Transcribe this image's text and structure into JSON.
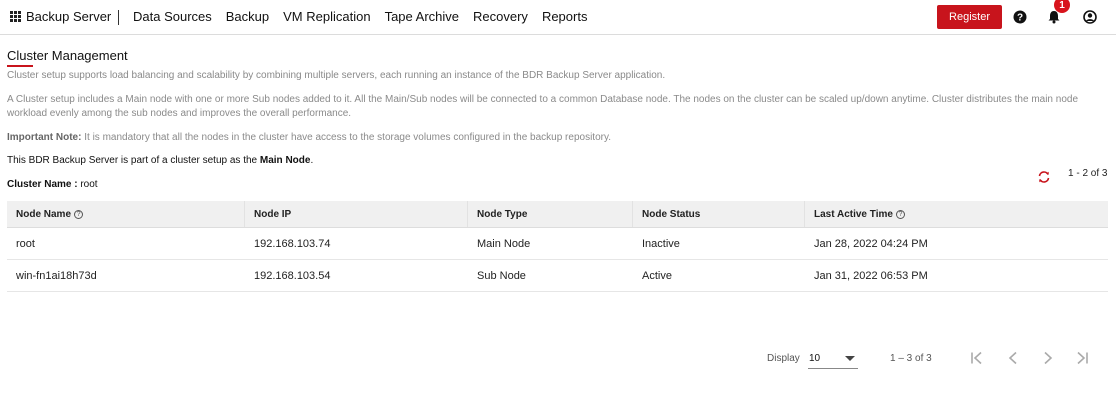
{
  "app": {
    "brand": "Backup Server"
  },
  "nav": {
    "items": [
      "Data Sources",
      "Backup",
      "VM Replication",
      "Tape Archive",
      "Recovery",
      "Reports"
    ]
  },
  "header": {
    "register_label": "Register",
    "notification_count": "1"
  },
  "page": {
    "title": "Cluster Management",
    "p1": "Cluster setup supports load balancing and scalability by combining multiple servers, each running an instance of the BDR Backup Server application.",
    "p2": "A Cluster setup includes a Main node with one or more Sub nodes added to it. All the Main/Sub nodes will be connected to a common Database node. The nodes on the cluster can be scaled up/down anytime. Cluster distributes the main node workload evenly among the sub nodes and improves the overall performance.",
    "note_label": "Important Note:",
    "note_text": " It is mandatory that all the nodes in the cluster have access to the storage volumes configured in the backup repository.",
    "main_info_prefix": "This BDR Backup Server is part of a cluster setup as the ",
    "main_info_role": "Main Node",
    "main_info_suffix": ".",
    "cluster_name_label": "Cluster Name :",
    "cluster_name_value": " root",
    "count_top": "1 - 2 of 3"
  },
  "table": {
    "headers": [
      "Node Name",
      "Node IP",
      "Node Type",
      "Node Status",
      "Last Active Time"
    ],
    "rows": [
      [
        "root",
        "192.168.103.74",
        "Main Node",
        "Inactive",
        "Jan 28, 2022 04:24 PM"
      ],
      [
        "win-fn1ai18h73d",
        "192.168.103.54",
        "Sub Node",
        "Active",
        "Jan 31, 2022 06:53 PM"
      ]
    ]
  },
  "pagination": {
    "display_label": "Display",
    "page_size": "10",
    "range": "1 – 3 of 3"
  },
  "colors": {
    "accent": "#c8141c"
  }
}
